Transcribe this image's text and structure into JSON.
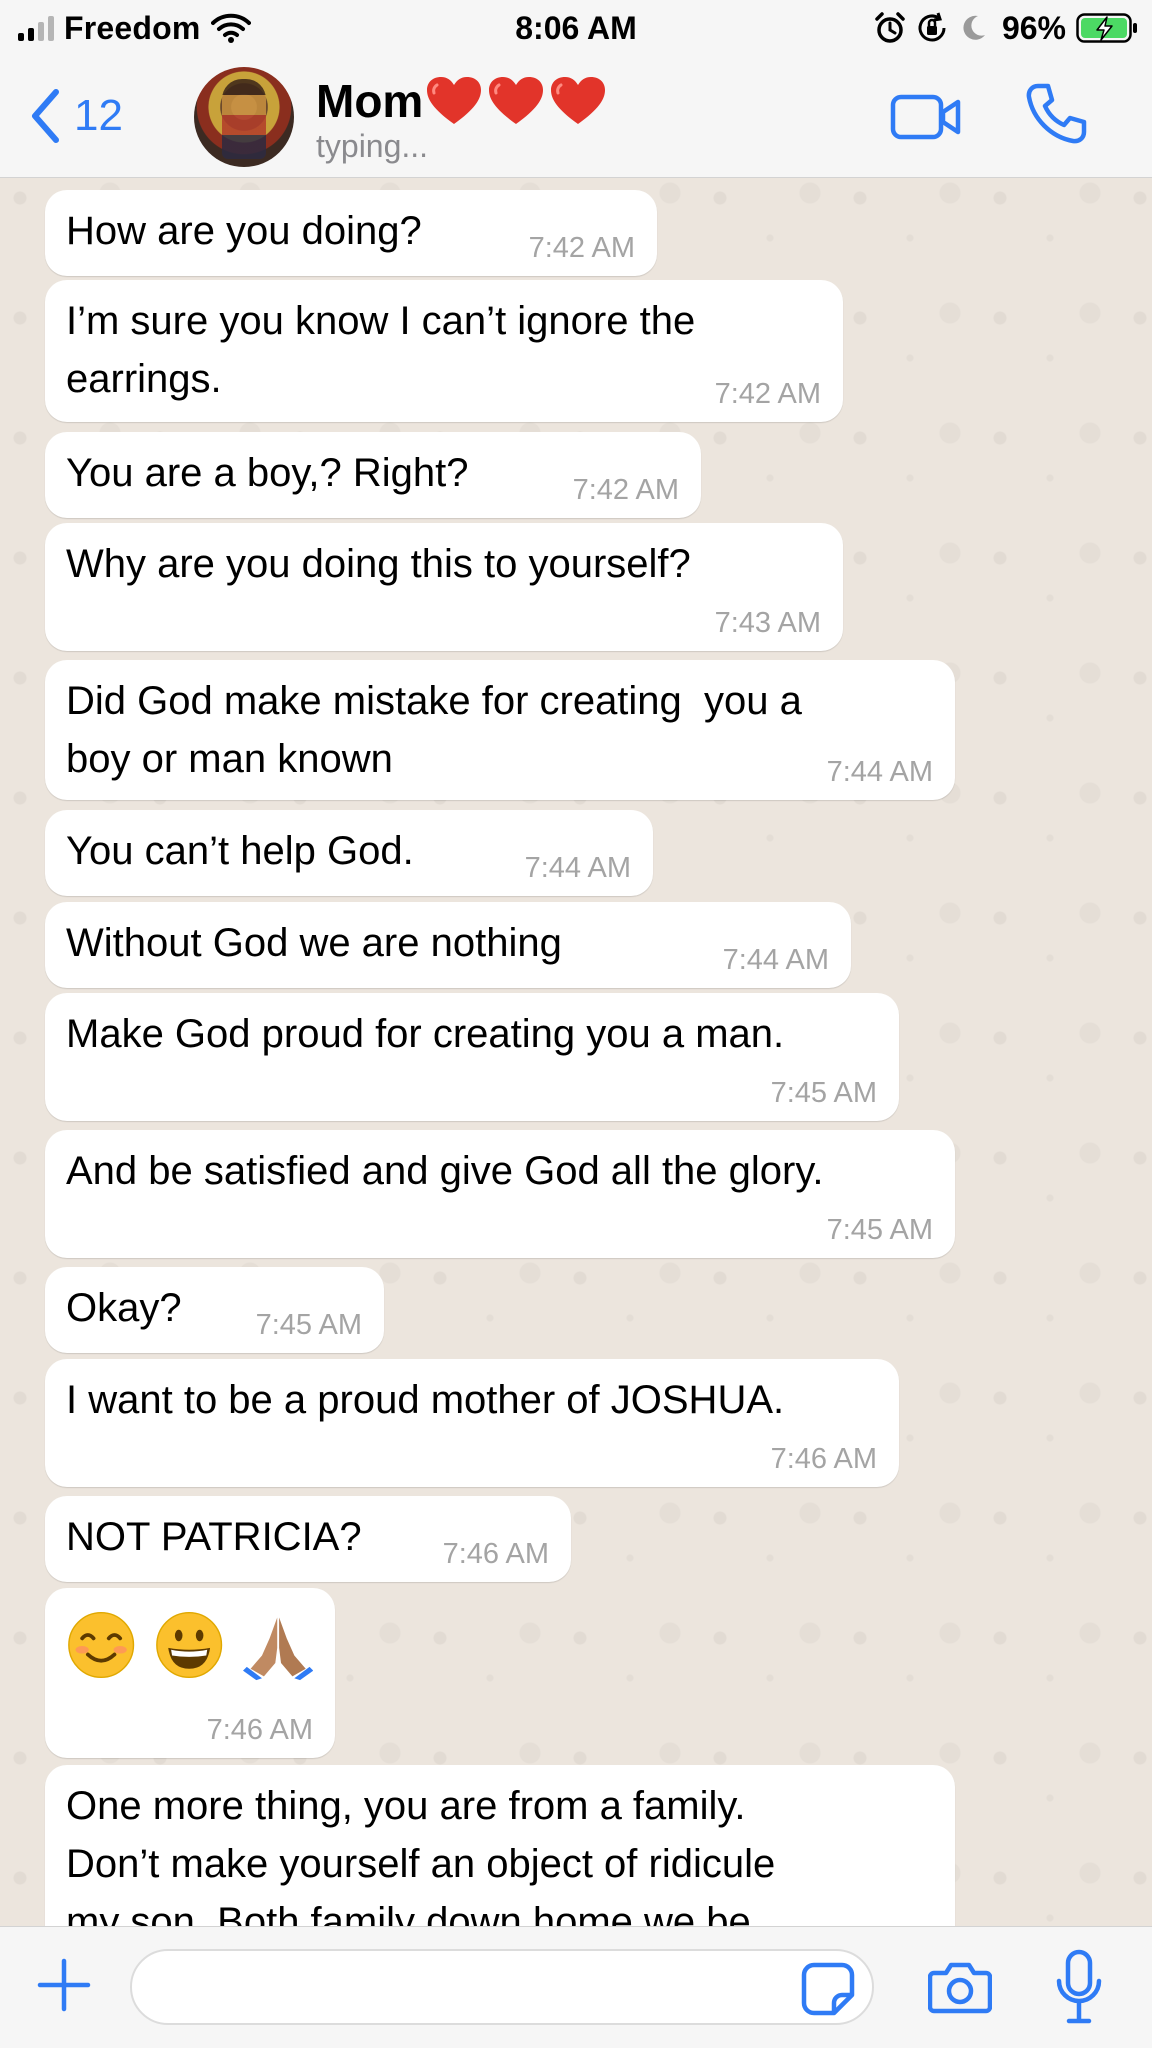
{
  "status_bar": {
    "carrier": "Freedom",
    "time": "8:06 AM",
    "battery_percent": "96%"
  },
  "header": {
    "back_count": "12",
    "contact_name": "Mom",
    "contact_suffix_emoji": "❤️❤️❤️",
    "subtitle": "typing...",
    "icons": [
      "chevron-left-icon",
      "video-call-icon",
      "phone-icon"
    ]
  },
  "messages": [
    {
      "text": "How are you doing?",
      "time": "7:42 AM"
    },
    {
      "text": "I’m sure you know I can’t ignore the\nearrings.",
      "time": "7:42 AM"
    },
    {
      "text": "You are a boy,? Right?",
      "time": "7:42 AM"
    },
    {
      "text": "Why are you doing this to yourself?",
      "time": "7:43 AM"
    },
    {
      "text": "Did God make mistake for creating  you a\nboy or man known",
      "time": "7:44 AM"
    },
    {
      "text": "You can’t help God.",
      "time": "7:44 AM"
    },
    {
      "text": "Without God we are nothing",
      "time": "7:44 AM"
    },
    {
      "text": "Make God proud for creating you a man.",
      "time": "7:45 AM"
    },
    {
      "text": "And be satisfied and give God all the glory.",
      "time": "7:45 AM"
    },
    {
      "text": "Okay?",
      "time": "7:45 AM"
    },
    {
      "text": "I want to be a proud mother of JOSHUA.",
      "time": "7:46 AM"
    },
    {
      "text": "NOT PATRICIA?",
      "time": "7:46 AM"
    },
    {
      "emoji": [
        "smiling-face-icon",
        "grinning-face-icon",
        "folded-hands-icon"
      ],
      "time": "7:46 AM"
    },
    {
      "text": "One more thing, you are from a family.\nDon’t make yourself an object of ridicule\nmy son. Both family down home we be",
      "time": ""
    }
  ],
  "input_bar": {
    "placeholder": "",
    "icons": [
      "plus-icon",
      "sticker-icon",
      "camera-icon",
      "microphone-icon"
    ]
  },
  "colors": {
    "accent": "#2f7bf5",
    "chat_background": "#ece5dd",
    "bubble": "#ffffff",
    "timestamp": "#a4a4a4",
    "battery_fill": "#4cd964"
  }
}
